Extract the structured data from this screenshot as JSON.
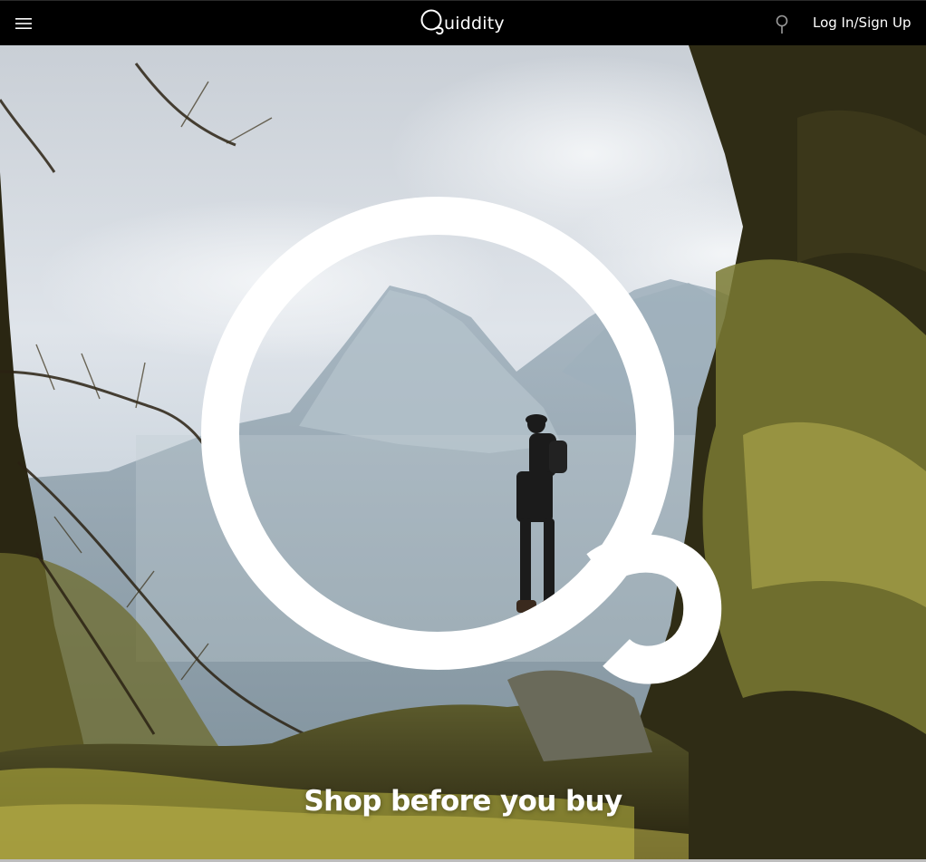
{
  "header": {
    "menu_icon": "hamburger-menu-icon",
    "logo_text": "uiddity",
    "logo_icon": "quiddity-q-logo-icon",
    "location_icon": "location-pin-icon",
    "login_label": "Log In/Sign Up"
  },
  "hero": {
    "tagline": "Shop before you buy",
    "image_subject": "hiker-mountain-photo",
    "overlay_icon": "quiddity-q-mark"
  },
  "colors": {
    "header_bg": "#000000",
    "text": "#ffffff",
    "overlay": "#ffffff"
  }
}
